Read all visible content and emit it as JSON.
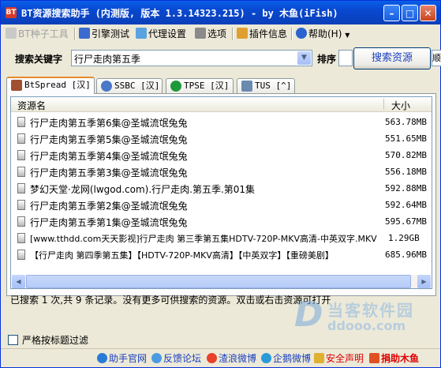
{
  "window": {
    "title": "BT资源搜索助手 (内测版, 版本 1.3.14323.215) - by 木鱼(iFish)"
  },
  "menu": {
    "bt_tool": "BT种子工具",
    "engine_test": "引擎测试",
    "proxy": "代理设置",
    "options": "选项",
    "plugin_info": "插件信息",
    "help": "帮助(H)"
  },
  "search": {
    "keyword_label": "搜索关键字",
    "keyword_value": "行尸走肉第五季",
    "sort_label": "排序",
    "search_button": "搜索资源",
    "cut_button": "顺"
  },
  "tabs": [
    {
      "label": "BtSpread [汉]"
    },
    {
      "label": "SSBC [汉]"
    },
    {
      "label": "TPSE [汉]"
    },
    {
      "label": "TUS [^]"
    }
  ],
  "table": {
    "col_name": "资源名",
    "col_size": "大小",
    "rows": [
      {
        "name": "行尸走肉第五季第6集@圣城流氓兔兔",
        "size": "563.78MB"
      },
      {
        "name": "行尸走肉第五季第5集@圣城流氓兔兔",
        "size": "551.65MB"
      },
      {
        "name": "行尸走肉第五季第4集@圣城流氓兔兔",
        "size": "570.82MB"
      },
      {
        "name": "行尸走肉第五季第3集@圣城流氓兔兔",
        "size": "556.18MB"
      },
      {
        "name": "梦幻天堂·龙网(lwgod.com).行尸走肉.第五季.第01集",
        "size": "592.88MB"
      },
      {
        "name": "行尸走肉第五季第2集@圣城流氓兔兔",
        "size": "592.64MB"
      },
      {
        "name": "行尸走肉第五季第1集@圣城流氓兔兔",
        "size": "595.67MB"
      },
      {
        "name": "[www.tthdd.com天天影视]行尸走肉 第三季第五集HDTV-720P-MKV高清-中英双字.MKV",
        "size": "1.29GB"
      },
      {
        "name": "【行尸走肉 第四季第五集】【HDTV-720P-MKV高清】【中英双字】【重磅美剧】",
        "size": "685.96MB"
      }
    ]
  },
  "status_text": "已搜索 1 次,共 9 条记录。没有更多可供搜索的资源。双击或右击资源可打开",
  "watermark": {
    "title": "当客软件园",
    "url": "ddooo.com"
  },
  "filter_checkbox": "严格按标题过滤",
  "bottom_links": {
    "home": "助手官网",
    "forum": "反馈论坛",
    "weibo": "渣浪微博",
    "penguin": "企鹅微博",
    "security": "安全声明",
    "donate": "捐助木鱼"
  },
  "colors": {
    "title_bar": "#0848d0",
    "donate_red": "#e00000",
    "link_blue": "#1a3fbf"
  }
}
